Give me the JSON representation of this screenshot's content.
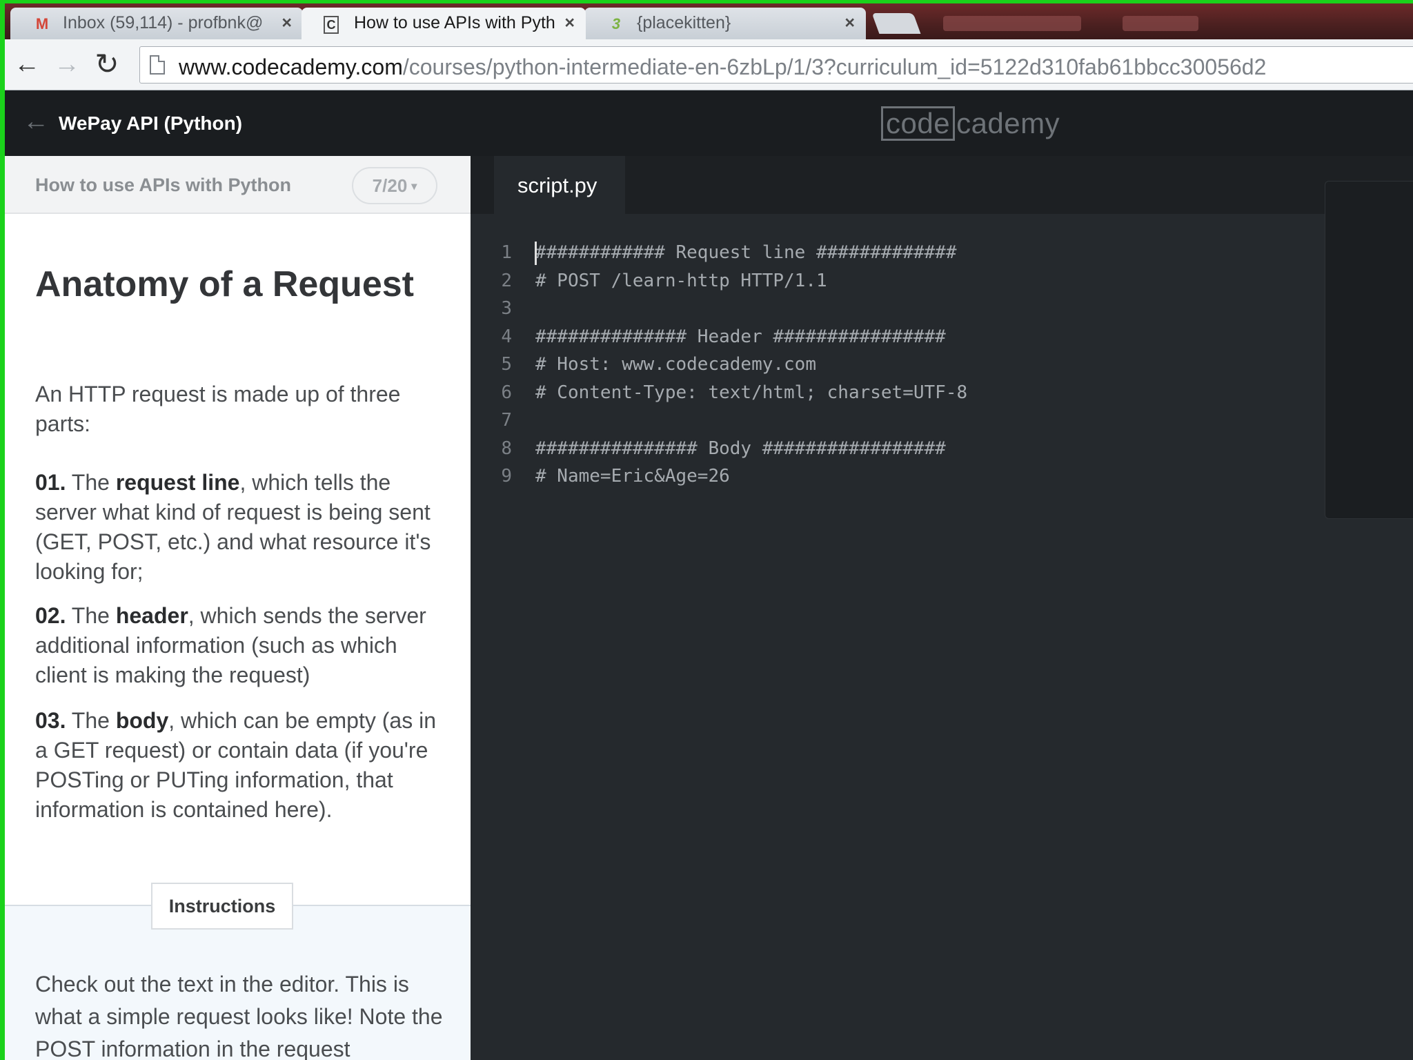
{
  "browser": {
    "tabs": [
      {
        "title": "Inbox (59,114) - profbnk@",
        "favicon": "M",
        "icon_name": "gmail-icon",
        "active": false
      },
      {
        "title": "How to use APIs with Pyth",
        "favicon": "C",
        "icon_name": "codecademy-icon",
        "active": true
      },
      {
        "title": "{placekitten}",
        "favicon": "3",
        "icon_name": "placekitten-icon",
        "active": false
      }
    ],
    "close_glyph": "×",
    "url_host": "www.codecademy.com",
    "url_path": "/courses/python-intermediate-en-6zbLp/1/3?curriculum_id=5122d310fab61bbcc30056d2",
    "back_glyph": "←",
    "forward_glyph": "→",
    "reload_glyph": "↻"
  },
  "header": {
    "back_glyph": "←",
    "course_title": "WePay API (Python)",
    "logo_box": "code",
    "logo_rest": "cademy"
  },
  "lesson": {
    "nav_title": "How to use APIs with Python",
    "progress": "7/20",
    "caret": "▾",
    "heading": "Anatomy of a Request",
    "intro": "An HTTP request is made up of three parts:",
    "items": [
      {
        "num": "01.",
        "pre": "The ",
        "bold": "request line",
        "rest": ", which tells the server what kind of request is being sent (GET, POST, etc.) and what resource it's looking for;"
      },
      {
        "num": "02.",
        "pre": "The ",
        "bold": "header",
        "rest": ", which sends the server additional information (such as which client is making the request)"
      },
      {
        "num": "03.",
        "pre": "The ",
        "bold": "body",
        "rest": ", which can be empty (as in a GET request) or contain data (if you're POSTing or PUTing information, that information is contained here)."
      }
    ],
    "instructions_tab": "Instructions",
    "instructions_text": "Check out the text in the editor. This is what a simple request looks like! Note the POST information in the request"
  },
  "editor": {
    "file_name": "script.py",
    "lines": [
      "############ Request line #############",
      "# POST /learn-http HTTP/1.1",
      "",
      "############## Header ################",
      "# Host: www.codecademy.com",
      "# Content-Type: text/html; charset=UTF-8",
      "",
      "############### Body #################",
      "# Name=Eric&Age=26"
    ],
    "line_numbers": [
      "1",
      "2",
      "3",
      "4",
      "5",
      "6",
      "7",
      "8",
      "9"
    ]
  },
  "colors": {
    "border_green": "#1bd21b",
    "header_bg": "#1a1d20",
    "editor_bg": "#25292d",
    "gmail_red": "#d44638",
    "kitten_green": "#7cb342"
  }
}
